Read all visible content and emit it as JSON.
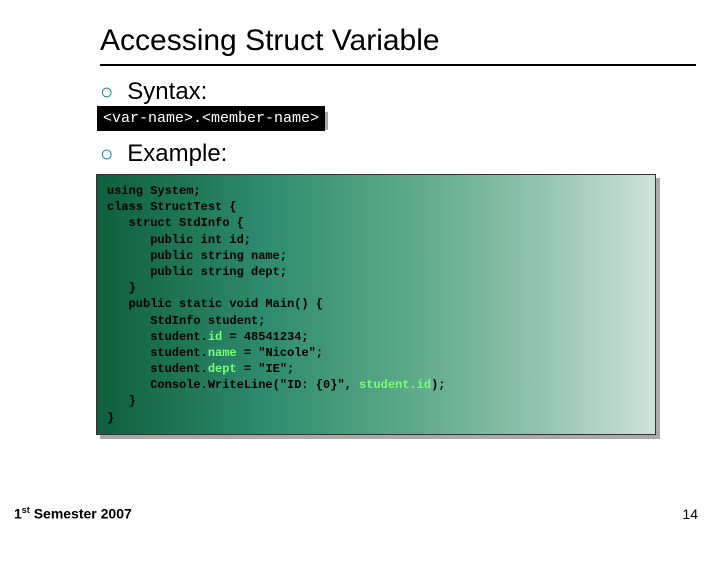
{
  "title": "Accessing Struct Variable",
  "bullets": {
    "syntax_label": "Syntax:",
    "example_label": "Example:"
  },
  "syntax_text": "<var-name>.<member-name>",
  "code": {
    "l01": "using System;",
    "l02": "class StructTest {",
    "l03": "   struct StdInfo {",
    "l04": "      public int id;",
    "l05": "      public string name;",
    "l06": "      public string dept;",
    "l07": "   }",
    "l08": "   public static void Main() {",
    "l09": "      StdInfo student;",
    "l10a": "      student.",
    "l10b": "id",
    "l10c": " = 48541234;",
    "l11a": "      student.",
    "l11b": "name",
    "l11c": " = \"Nicole\";",
    "l12a": "      student.",
    "l12b": "dept",
    "l12c": " = \"IE\";",
    "l13a": "      Console.WriteLine(\"ID: {0}\", ",
    "l13b": "student.id",
    "l13c": ");",
    "l14": "   }",
    "l15": "}"
  },
  "footer": {
    "left_pre": "1",
    "left_sup": "st",
    "left_post": " Semester 2007",
    "page": "14"
  }
}
